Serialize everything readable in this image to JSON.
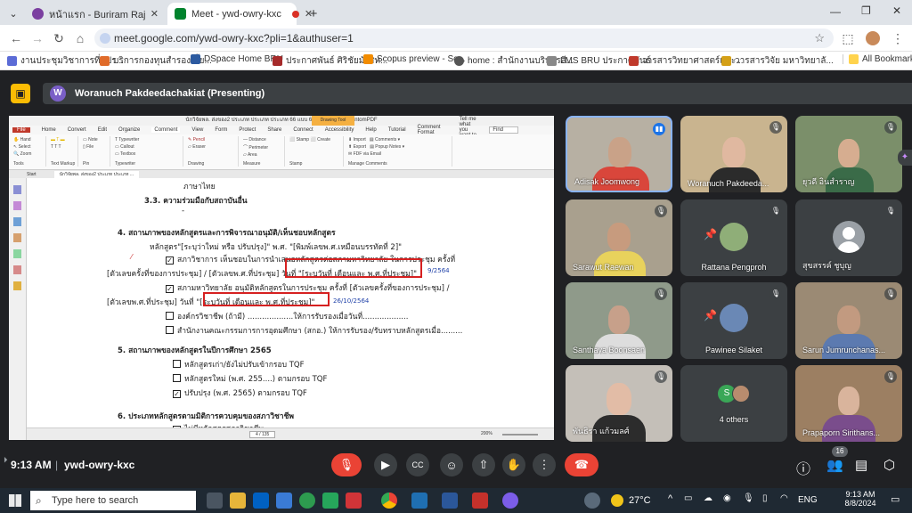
{
  "browser": {
    "tabs": [
      {
        "title": "หน้าแรก - Buriram Rajabhat Univ",
        "active": false
      },
      {
        "title": "Meet - ywd-owry-kxc",
        "active": true
      }
    ],
    "new_tab": "+",
    "url": "meet.google.com/ywd-owry-kxc?pli=1&authuser=1",
    "bookmarks": [
      "งานประชุมวิชาการที่แปร...",
      "บริการกองทุนสำรองเลี้ย...",
      "DSpace Home BRU",
      "ประกาศพันธ์ ศิริชัยมังสิท...",
      "Scopus preview - Sc...",
      "home : สำนักงานบริหารสี...",
      "LMS BRU ประกาศพันธ์",
      "วารสารวิทยาศาสตร์และ...",
      "วารสารวิจัย มหาวิทยาลั..."
    ],
    "all_bookmarks": "All Bookmarks"
  },
  "meet": {
    "presenter_initial": "W",
    "presenting": "Woranuch Pakdeedachakiat (Presenting)",
    "time": "9:13 AM",
    "meeting_code": "ywd-owry-kxc",
    "participant_count": "16",
    "accent": "#1a73e8",
    "end_color": "#ea4335",
    "participants": [
      {
        "name": "Adisak Joomwong",
        "speaking": true
      },
      {
        "name": "Woranuch Pakdeeda...",
        "muted": true
      },
      {
        "name": "ยุวดี อินสำราญ",
        "muted": true
      },
      {
        "name": "Sarawut Raewan",
        "muted": true
      },
      {
        "name": "Rattana Pengproh",
        "muted": true,
        "pinned": true
      },
      {
        "name": "สุขสรรค์ ชูบุญ",
        "muted": true
      },
      {
        "name": "Santhaya Boonsaen",
        "muted": true
      },
      {
        "name": "Pawinee Silaket",
        "muted": true,
        "pinned": true
      },
      {
        "name": "Sarun Jumrunchanas...",
        "muted": true
      },
      {
        "name": "พันธิรา แก้วมลศ์",
        "muted": true
      },
      {
        "name": "4 others",
        "avatar": "S"
      },
      {
        "name": "Prapaporn Sirithans...",
        "muted": true
      }
    ]
  },
  "pdf": {
    "window_title": "นักวิจัยพล. ส่งของ2 ประเภท ประเภท ประเภท 66 แบบ 67.pdf * - Foxit PhantomPDF",
    "menu": [
      "File",
      "Home",
      "Convert",
      "Edit",
      "Organize",
      "Comment",
      "View",
      "Form",
      "Protect",
      "Share",
      "Connect",
      "Accessibility",
      "Help",
      "Tutorial",
      "Comment Format"
    ],
    "tell_me": "Tell me what you want to do...",
    "find_placeholder": "Find",
    "ribbon_groups": [
      "Tools",
      "Text Markup",
      "Pin",
      "Typewriter",
      "Drawing",
      "Measure",
      "Stamp",
      "Manage Comments"
    ],
    "doc_tabs": [
      "Start",
      "นักวิจัยพล. ส่งของ2 ประเภท ประเภท ..."
    ],
    "page_indicator": "4 / 135",
    "zoom": "200%",
    "lines": {
      "l1": "ภาษาไทย",
      "l2": "3.3. ความร่วมมือกับสถาบันอื่น",
      "l3": "-",
      "l4": "4. สถานภาพของหลักสูตรและการพิจารณาอนุมัติ/เห็นชอบหลักสูตร",
      "l5": "หลักสูตร\"[ระบุว่าใหม่ หรือ ปรับปรุง]\" พ.ศ. \"[พิมพ์เลขพ.ศ.เหมือนบรรทัดที่ 2]\"",
      "l6": "สภาวิชาการ เห็นชอบในการนำเสนอหลักสูตรต่อสภามหาวิทยาลัย ในการประชุม ครั้งที่",
      "l7a": "[ตัวเลขครั้งที่ของการประชุม] / [ตัวเลขพ.ศ.ที่ประชุม]",
      "l7b": "วันที่ \"[ระบุวันที่ เดือนและ พ.ศ.ที่ประชุม]\"",
      "l7c": "9/2564",
      "l8": "สภามหาวิทยาลัย อนุมัติหลักสูตรในการประชุม ครั้งที่ [ตัวเลขครั้งที่ของการประชุม] /",
      "l9a": "[ตัวเลขพ.ศ.ที่ประชุม]  วันที่",
      "l9b": "\"[ระบุวันที่ เดือนและ พ.ศ.ที่ประชุม]\"",
      "l9c": "26/10/2564",
      "l10": "องค์กรวิชาชีพ (ถ้ามี) ...................ให้การรับรองเมื่อวันที่...................",
      "l11": "สำนักงานคณะกรรมการการอุดมศึกษา (สกอ.) ให้การรับรอง/รับทราบหลักสูตรเมื่อ.........",
      "l12": "5. สถานภาพของหลักสูตรในปีการศึกษา 2565",
      "l13": "หลักสูตรเก่า/ยังไม่ปรับเข้ากรอบ TQF",
      "l14": "หลักสูตรใหม่ (พ.ศ. 255....)  ตามกรอบ TQF",
      "l15": "ปรับปรุง (พ.ศ. 2565)  ตามกรอบ TQF",
      "l16": "6. ประเภทหลักสูตรตามมิติการควบคุมของสภาวิชาชีพ",
      "l17": "ไม่มีหลักสูตรสภาวิชาชีพ"
    }
  },
  "taskbar": {
    "search": "Type here to search",
    "weather": "27°C",
    "lang": "ENG",
    "time": "9:13 AM",
    "date": "8/8/2024"
  }
}
